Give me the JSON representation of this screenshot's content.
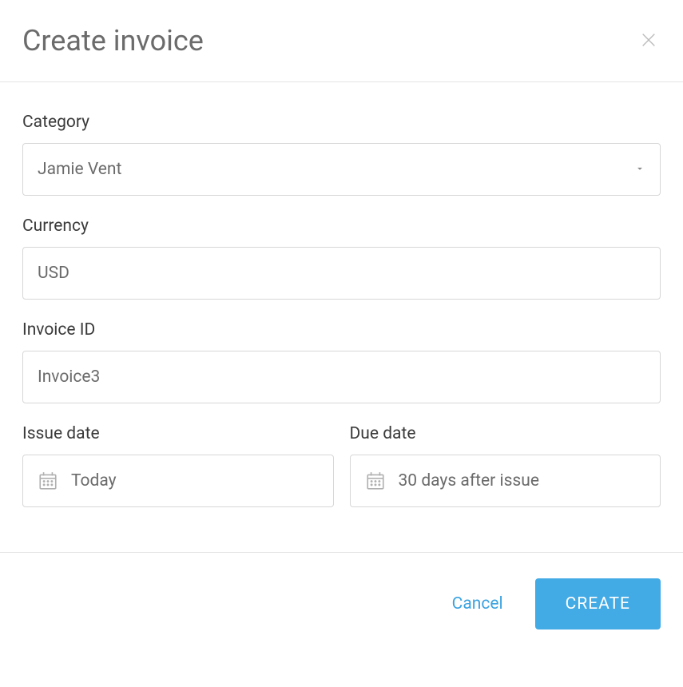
{
  "header": {
    "title": "Create invoice"
  },
  "form": {
    "category": {
      "label": "Category",
      "value": "Jamie Vent"
    },
    "currency": {
      "label": "Currency",
      "value": "USD"
    },
    "invoiceId": {
      "label": "Invoice ID",
      "value": "Invoice3"
    },
    "issueDate": {
      "label": "Issue date",
      "value": "Today"
    },
    "dueDate": {
      "label": "Due date",
      "value": "30 days after issue"
    }
  },
  "footer": {
    "cancel": "Cancel",
    "create": "CREATE"
  }
}
